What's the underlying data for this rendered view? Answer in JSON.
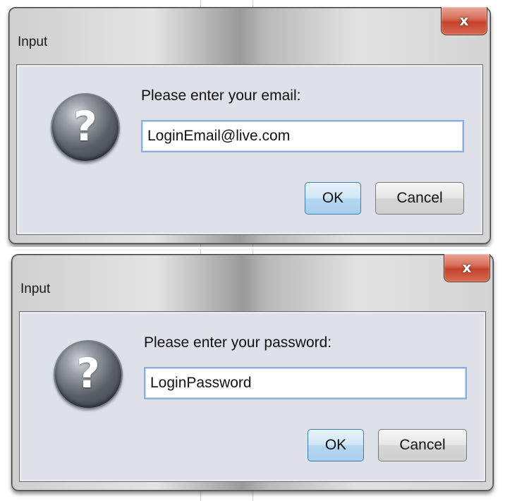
{
  "dialogs": [
    {
      "title": "Input",
      "close_label": "x",
      "prompt": "Please enter your email:",
      "input_value": "LoginEmail@live.com",
      "icon": "question-icon",
      "icon_glyph": "?",
      "ok_label": "OK",
      "cancel_label": "Cancel"
    },
    {
      "title": "Input",
      "close_label": "x",
      "prompt": "Please enter your password:",
      "input_value": "LoginPassword",
      "icon": "question-icon",
      "icon_glyph": "?",
      "ok_label": "OK",
      "cancel_label": "Cancel"
    }
  ],
  "colors": {
    "close_button": "#c5432c",
    "content_bg": "#dee1ea",
    "ok_button": "#b6d7f0"
  }
}
